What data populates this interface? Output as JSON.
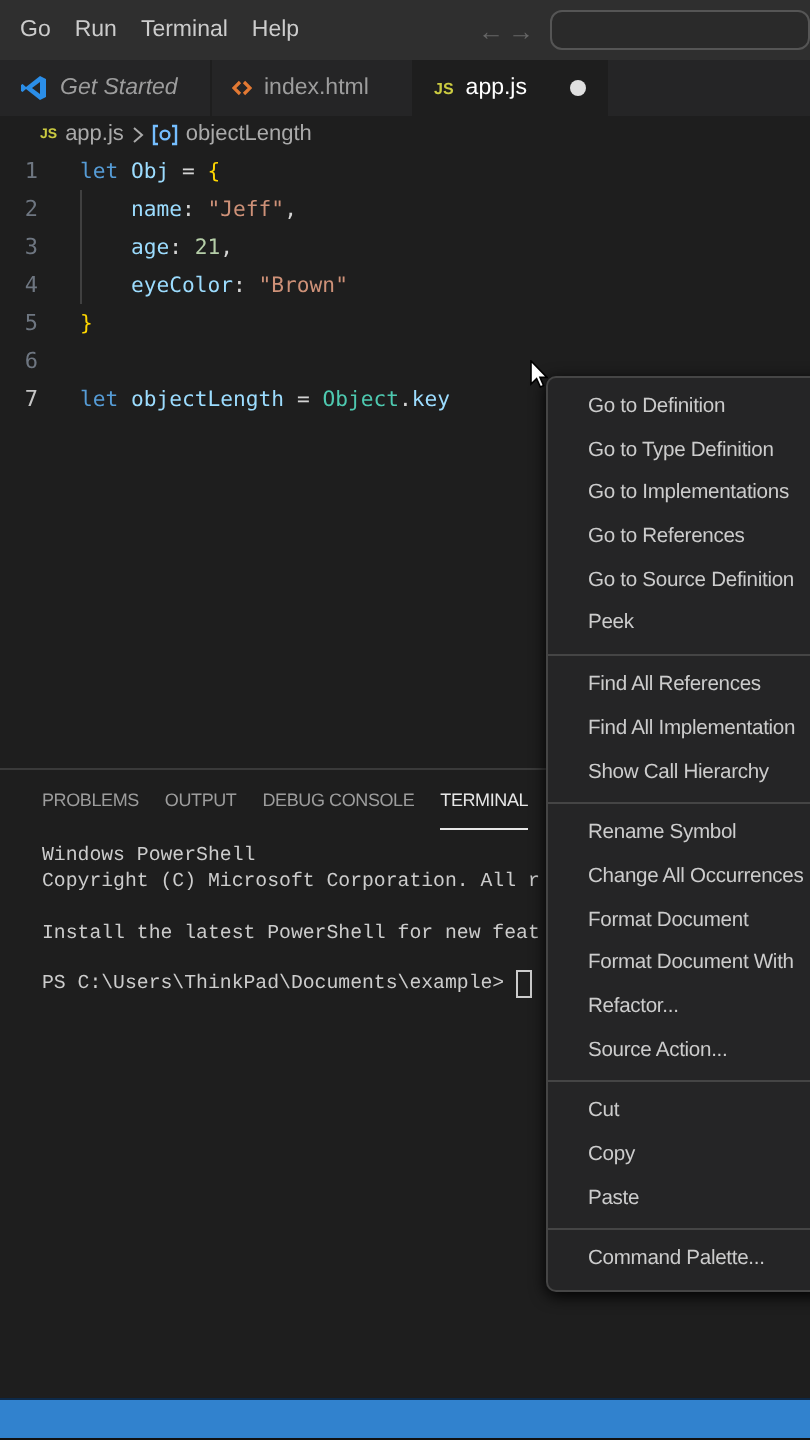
{
  "menu_bar": {
    "items": [
      "Go",
      "Run",
      "Terminal",
      "Help"
    ],
    "back": "←",
    "forward": "→"
  },
  "tabs": [
    {
      "label": "Get Started",
      "kind": "welcome",
      "selected": false,
      "modified": false
    },
    {
      "label": "index.html",
      "kind": "html",
      "selected": false,
      "modified": false
    },
    {
      "label": "app.js",
      "kind": "js",
      "icon_text": "JS",
      "selected": true,
      "modified": true
    }
  ],
  "breadcrumb": {
    "file_icon_text": "JS",
    "file": "app.js",
    "symbol": "objectLength"
  },
  "code_lines": [
    {
      "number": "1",
      "current": false,
      "tokens": [
        {
          "kind": "keyword",
          "text": "let "
        },
        {
          "kind": "variable",
          "text": "Obj"
        },
        {
          "kind": "punct",
          "text": " = "
        },
        {
          "kind": "brace",
          "text": "{"
        }
      ]
    },
    {
      "number": "2",
      "current": false,
      "indented": true,
      "tokens": [
        {
          "kind": "property",
          "text": "name"
        },
        {
          "kind": "punct",
          "text": ": "
        },
        {
          "kind": "string",
          "text": "\"Jeff\""
        },
        {
          "kind": "punct",
          "text": ","
        }
      ]
    },
    {
      "number": "3",
      "current": false,
      "indented": true,
      "tokens": [
        {
          "kind": "property",
          "text": "age"
        },
        {
          "kind": "punct",
          "text": ": "
        },
        {
          "kind": "number",
          "text": "21"
        },
        {
          "kind": "punct",
          "text": ","
        }
      ]
    },
    {
      "number": "4",
      "current": false,
      "indented": true,
      "tokens": [
        {
          "kind": "property",
          "text": "eyeColor"
        },
        {
          "kind": "punct",
          "text": ": "
        },
        {
          "kind": "string",
          "text": "\"Brown\""
        }
      ]
    },
    {
      "number": "5",
      "current": false,
      "tokens": [
        {
          "kind": "brace",
          "text": "}"
        }
      ]
    },
    {
      "number": "6",
      "current": false
    },
    {
      "number": "7",
      "current": true,
      "tokens": [
        {
          "kind": "keyword",
          "text": "let "
        },
        {
          "kind": "variable",
          "text": "objectLength"
        },
        {
          "kind": "punct",
          "text": " = "
        },
        {
          "kind": "class",
          "text": "Object"
        },
        {
          "kind": "punct",
          "text": "."
        },
        {
          "kind": "variable",
          "text": "key"
        }
      ]
    }
  ],
  "panel_tabs": [
    {
      "label": "PROBLEMS",
      "selected": false
    },
    {
      "label": "OUTPUT",
      "selected": false
    },
    {
      "label": "DEBUG CONSOLE",
      "selected": false
    },
    {
      "label": "TERMINAL",
      "selected": true
    }
  ],
  "terminal_blocks": [
    [
      "Windows PowerShell",
      "Copyright (C) Microsoft Corporation. All r"
    ],
    [
      "Install the latest PowerShell for new feat"
    ],
    [
      "PS C:\\Users\\ThinkPad\\Documents\\example>"
    ]
  ],
  "context_menu": [
    [
      "Go to Definition",
      "Go to Type Definition",
      "Go to Implementations",
      "Go to References",
      "Go to Source Definition",
      "Peek"
    ],
    [
      "Find All References",
      "Find All Implementation",
      "Show Call Hierarchy"
    ],
    [
      "Rename Symbol",
      "Change All Occurrences",
      "Format Document",
      "Format Document With",
      "Refactor...",
      "Source Action..."
    ],
    [
      "Cut",
      "Copy",
      "Paste"
    ],
    [
      "Command Palette..."
    ]
  ]
}
